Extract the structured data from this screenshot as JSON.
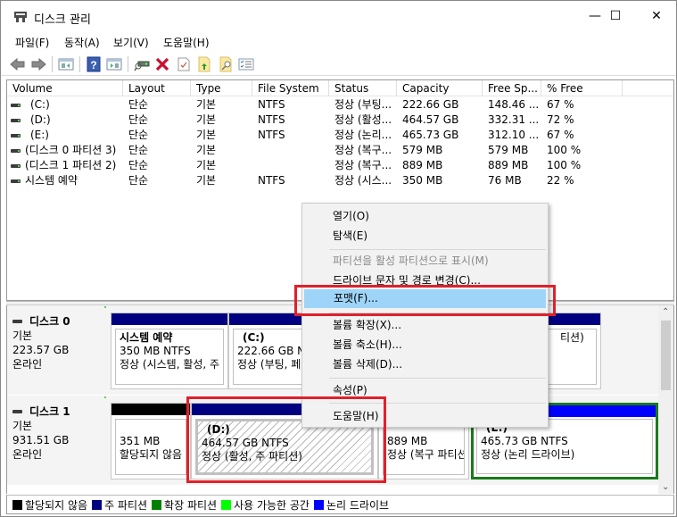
{
  "window": {
    "title": "디스크 관리",
    "controls": {
      "minimize": "—",
      "maximize": "☐",
      "close": "✕"
    }
  },
  "menubar": {
    "items": [
      {
        "label": "파일(F)"
      },
      {
        "label": "동작(A)"
      },
      {
        "label": "보기(V)"
      },
      {
        "label": "도움말(H)"
      }
    ]
  },
  "toolbar": {
    "icons": [
      "back-icon",
      "forward-icon",
      "show-hide-console-tree-icon",
      "help-icon",
      "show-hide-action-pane-icon",
      "connect-drive-icon",
      "delete-icon",
      "properties-check-icon",
      "export-list-icon",
      "search-icon",
      "settings-list-icon"
    ]
  },
  "volume_list": {
    "columns": [
      "Volume",
      "Layout",
      "Type",
      "File System",
      "Status",
      "Capacity",
      "Free Sp...",
      "% Free"
    ],
    "rows": [
      {
        "volume": "(C:)",
        "layout": "단순",
        "type": "기본",
        "fs": "NTFS",
        "status": "정상 (부팅...",
        "capacity": "222.66 GB",
        "free": "148.46 ...",
        "pct": "67 %"
      },
      {
        "volume": "(D:)",
        "layout": "단순",
        "type": "기본",
        "fs": "NTFS",
        "status": "정상 (활성...",
        "capacity": "464.57 GB",
        "free": "332.31 ...",
        "pct": "72 %"
      },
      {
        "volume": "(E:)",
        "layout": "단순",
        "type": "기본",
        "fs": "NTFS",
        "status": "정상 (논리...",
        "capacity": "465.73 GB",
        "free": "312.10 ...",
        "pct": "67 %"
      },
      {
        "volume": "(디스크 0 파티션 3)",
        "layout": "단순",
        "type": "기본",
        "fs": "",
        "status": "정상 (복구...",
        "capacity": "579 MB",
        "free": "579 MB",
        "pct": "100 %"
      },
      {
        "volume": "(디스크 1 파티션 2)",
        "layout": "단순",
        "type": "기본",
        "fs": "",
        "status": "정상 (복구...",
        "capacity": "889 MB",
        "free": "889 MB",
        "pct": "100 %"
      },
      {
        "volume": "시스템 예약",
        "layout": "단순",
        "type": "기본",
        "fs": "NTFS",
        "status": "정상 (시스...",
        "capacity": "350 MB",
        "free": "76 MB",
        "pct": "22 %"
      }
    ]
  },
  "disks": [
    {
      "name": "디스크 0",
      "type": "기본",
      "size": "223.57 GB",
      "state": "온라인",
      "partitions": [
        {
          "name": "시스템 예약",
          "size": "350 MB NTFS",
          "status": "정상 (시스템, 활성, 주"
        },
        {
          "name": "(C:)",
          "size": "222.66 GB NTFS",
          "status": "정상 (부팅, 페"
        },
        {
          "name": "",
          "size": "",
          "status": "티션)"
        }
      ]
    },
    {
      "name": "디스크 1",
      "type": "기본",
      "size": "931.51 GB",
      "state": "온라인",
      "partitions": [
        {
          "name": "",
          "size": "351 MB",
          "status": "할당되지 않음"
        },
        {
          "name": "(D:)",
          "size": "464.57 GB NTFS",
          "status": "정상 (활성, 주 파티션)"
        },
        {
          "name": "",
          "size": "889 MB",
          "status": "정상 (복구 파티션"
        },
        {
          "name": "(E:)",
          "size": "465.73 GB NTFS",
          "status": "정상 (논리 드라이브)"
        }
      ]
    }
  ],
  "legend": [
    {
      "label": "할당되지 않음",
      "color": "#000000"
    },
    {
      "label": "주 파티션",
      "color": "#000080"
    },
    {
      "label": "확장 파티션",
      "color": "#008000"
    },
    {
      "label": "사용 가능한 공간",
      "color": "#00ff00"
    },
    {
      "label": "논리 드라이브",
      "color": "#0000ff"
    }
  ],
  "context_menu": {
    "items": [
      {
        "label": "열기(O)",
        "enabled": true
      },
      {
        "label": "탐색(E)",
        "enabled": true
      },
      {
        "label": "파티션을 활성 파티션으로 표시(M)",
        "enabled": false
      },
      {
        "label": "드라이브 문자 및 경로 변경(C)...",
        "enabled": true
      },
      {
        "label": "포맷(F)...",
        "enabled": true,
        "highlighted": true
      },
      {
        "label": "볼륨 확장(X)...",
        "enabled": true
      },
      {
        "label": "볼륨 축소(H)...",
        "enabled": true
      },
      {
        "label": "볼륨 삭제(D)...",
        "enabled": true
      },
      {
        "label": "속성(P)",
        "enabled": true
      },
      {
        "label": "도움말(H)",
        "enabled": true
      }
    ]
  },
  "colors": {
    "primary_partition": "#000080",
    "logical_drive": "#0000ff",
    "extended_partition": "#1a7a1a",
    "unallocated": "#000000",
    "highlight": "#9ed4f8",
    "annotation_red": "#e0202a"
  }
}
